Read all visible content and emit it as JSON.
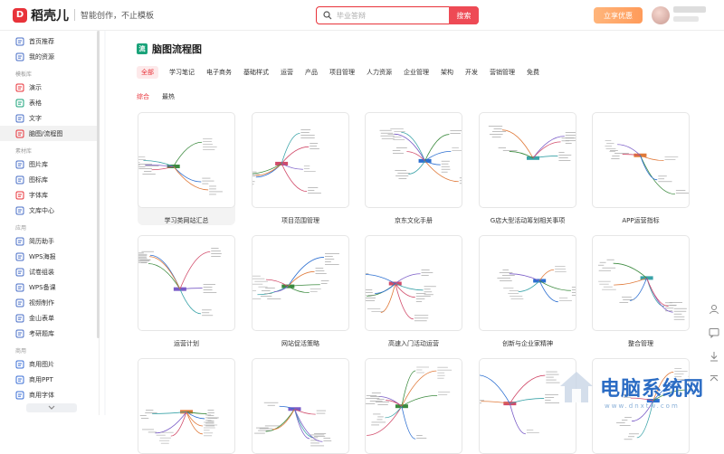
{
  "header": {
    "logo_mark": "D",
    "app_name": "稻壳儿",
    "slogan": "智能创作，不止模板",
    "search_placeholder": "毕业答辩",
    "search_button": "搜索",
    "vip_button": "立享优惠"
  },
  "sidebar": {
    "top_items": [
      {
        "label": "首页推荐",
        "icon": "home-icon"
      },
      {
        "label": "我的资源",
        "icon": "folder-icon"
      }
    ],
    "groups": [
      {
        "title": "模板库",
        "items": [
          {
            "label": "演示",
            "icon": "presentation-icon"
          },
          {
            "label": "表格",
            "icon": "spreadsheet-icon"
          },
          {
            "label": "文字",
            "icon": "document-icon"
          },
          {
            "label": "脑图/流程图",
            "icon": "mindmap-icon",
            "active": true
          }
        ]
      },
      {
        "title": "素材库",
        "items": [
          {
            "label": "图片库",
            "icon": "image-icon"
          },
          {
            "label": "图标库",
            "icon": "icon-library-icon"
          },
          {
            "label": "字体库",
            "icon": "font-icon"
          },
          {
            "label": "文库中心",
            "icon": "library-icon"
          }
        ]
      },
      {
        "title": "应用",
        "items": [
          {
            "label": "简历助手",
            "icon": "resume-icon"
          },
          {
            "label": "WPS海报",
            "icon": "poster-icon"
          },
          {
            "label": "试卷组装",
            "icon": "exam-icon"
          },
          {
            "label": "WPS备课",
            "icon": "lesson-icon"
          },
          {
            "label": "视频制作",
            "icon": "video-icon"
          },
          {
            "label": "金山表单",
            "icon": "form-icon"
          },
          {
            "label": "考研题库",
            "icon": "question-bank-icon"
          }
        ]
      },
      {
        "title": "商用",
        "items": [
          {
            "label": "商用图片",
            "icon": "commercial-image-icon"
          },
          {
            "label": "商用PPT",
            "icon": "commercial-ppt-icon"
          },
          {
            "label": "商用字体",
            "icon": "commercial-font-icon"
          }
        ]
      }
    ]
  },
  "main": {
    "title_icon": "流",
    "title": "脑图流程图",
    "tabs": [
      "全部",
      "学习笔记",
      "电子商务",
      "基础样式",
      "运营",
      "产品",
      "项目管理",
      "人力资源",
      "企业管理",
      "架构",
      "开发",
      "营销管理",
      "免费"
    ],
    "active_tab": "全部",
    "sorts": [
      "综合",
      "最热"
    ],
    "active_sort": "综合",
    "cards_row1": [
      "学习类网站汇总",
      "项目范围管理",
      "京东文化手册",
      "G店大型活动筹划相关事项",
      "APP运营指标"
    ],
    "cards_row2": [
      "运营计划",
      "网站促活策略",
      "高速入门活动运营",
      "创新与企业家精神",
      "整合管理"
    ]
  },
  "watermark": {
    "text": "电脑系统网",
    "url": "www.dnxtw.com"
  }
}
